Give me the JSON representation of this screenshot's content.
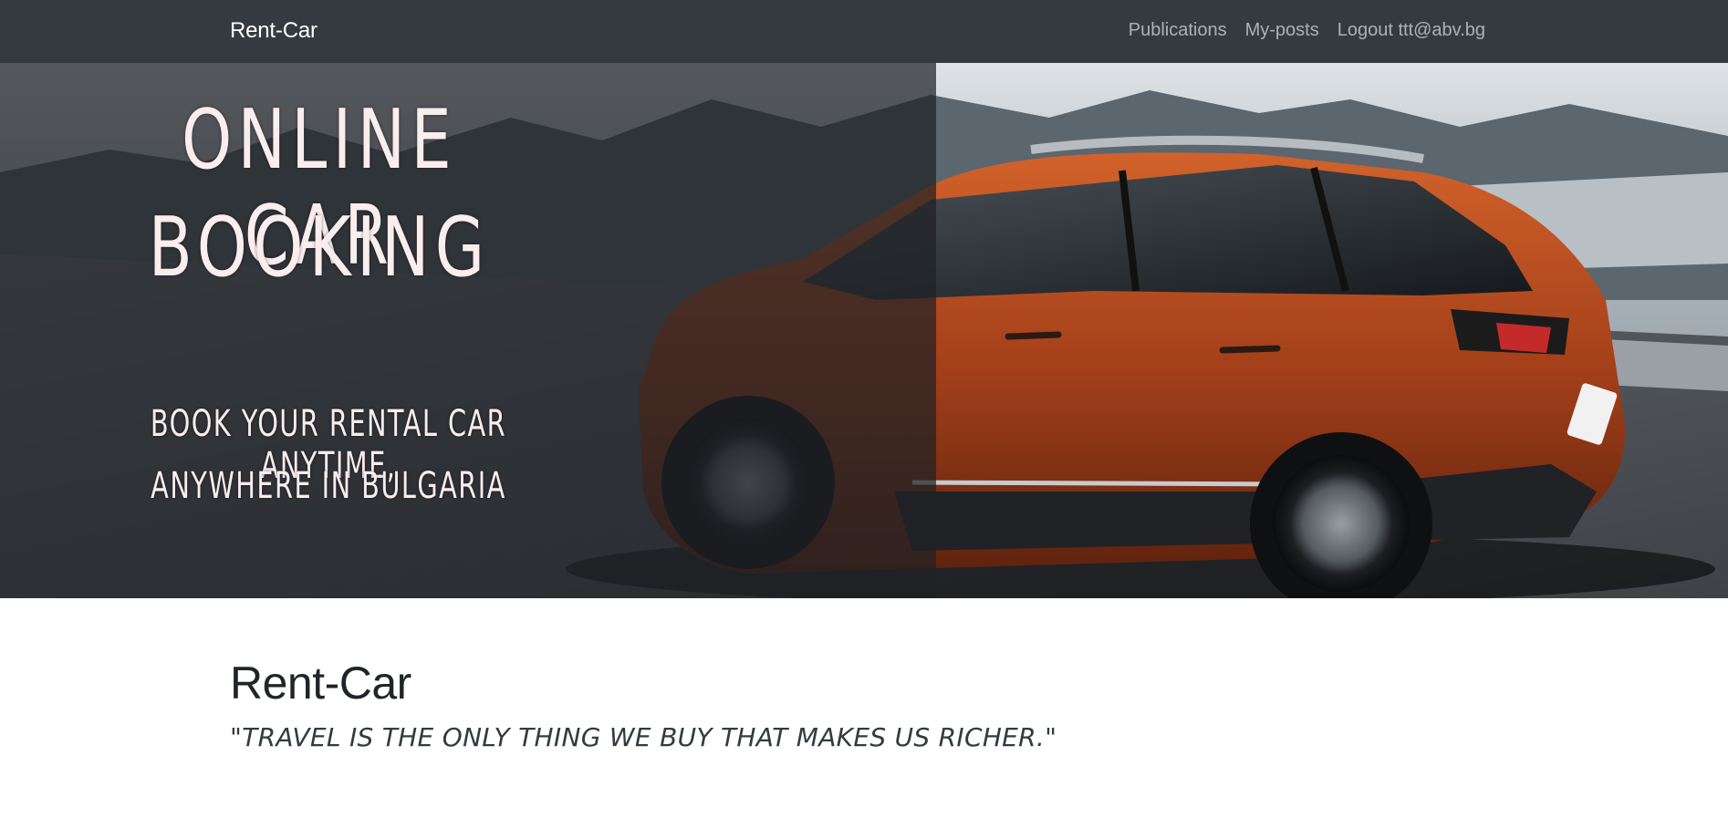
{
  "navbar": {
    "brand": "Rent-Car",
    "links": [
      "Publications",
      "My-posts",
      "Logout ttt@abv.bg"
    ]
  },
  "hero": {
    "title_line1": "ONLINE CAR",
    "title_line2": "BOOKING",
    "subtitle_line1": "BOOK YOUR RENTAL CAR ANYTIME,",
    "subtitle_line2": "ANYWHERE IN BULGARIA",
    "image_description": "orange SUV driving on a mountain road by the sea"
  },
  "main": {
    "heading": "Rent-Car",
    "tagline": "\"TRAVEL IS THE ONLY THING WE BUY THAT MAKES US RICHER.\""
  },
  "colors": {
    "navbar_bg": "#343a40",
    "nav_link": "#9a9da0",
    "car_body": "#b34a1c",
    "hero_text": "#f9eded"
  }
}
